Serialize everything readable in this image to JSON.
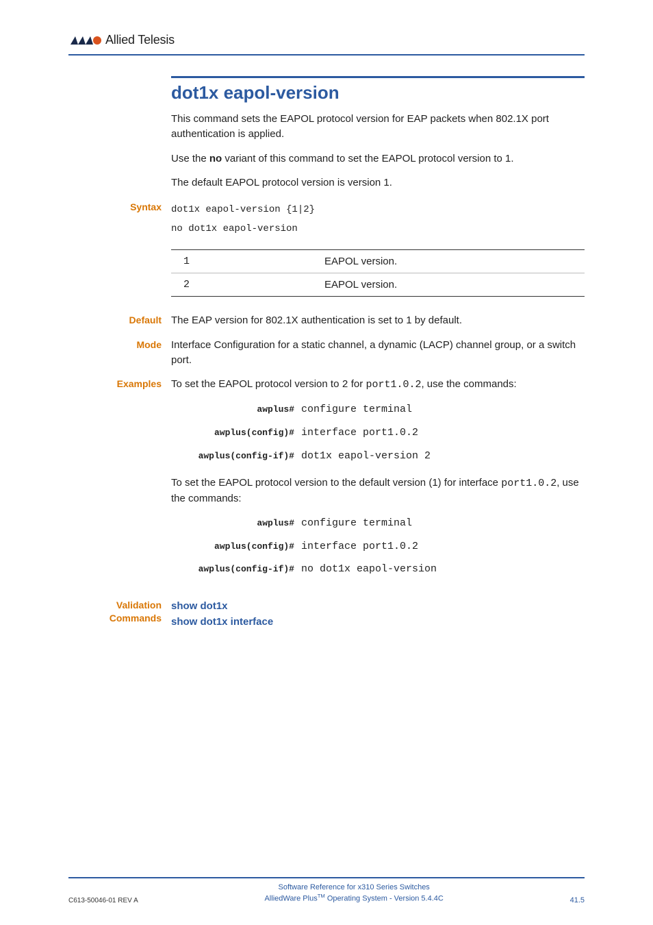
{
  "header": {
    "brand": "Allied Telesis"
  },
  "title": "dot1x eapol-version",
  "intro": {
    "p1": "This command sets the EAPOL protocol version for EAP packets when 802.1X port authentication is applied.",
    "p2_pre": "Use the ",
    "p2_bold": "no",
    "p2_post": " variant of this command to set the EAPOL protocol version to 1.",
    "p3": "The default EAPOL protocol version is version 1."
  },
  "labels": {
    "syntax": "Syntax",
    "default": "Default",
    "mode": "Mode",
    "examples": "Examples",
    "validation1": "Validation",
    "validation2": "Commands"
  },
  "syntax": {
    "line1": "dot1x eapol-version {1|2}",
    "line2": "no dot1x eapol-version"
  },
  "param_table": [
    {
      "param": "1",
      "desc": "EAPOL version."
    },
    {
      "param": "2",
      "desc": "EAPOL version."
    }
  ],
  "default_text": "The EAP version for 802.1X authentication is set to 1 by default.",
  "mode_text": "Interface Configuration for a static channel, a dynamic (LACP) channel group, or a switch port.",
  "examples": {
    "intro1_pre": "To set the EAPOL protocol version to ",
    "intro1_val": "2",
    "intro1_mid": " for ",
    "intro1_port": "port1.0.2",
    "intro1_post": ", use the commands:",
    "block1": [
      {
        "prompt": "awplus#",
        "cmd": "configure terminal"
      },
      {
        "prompt": "awplus(config)#",
        "cmd": "interface port1.0.2"
      },
      {
        "prompt": "awplus(config-if)#",
        "cmd": "dot1x eapol-version 2"
      }
    ],
    "intro2_pre": "To set the EAPOL protocol version to the default version (1) for interface ",
    "intro2_port": "port1.0.2",
    "intro2_post": ", use the commands:",
    "block2": [
      {
        "prompt": "awplus#",
        "cmd": "configure terminal"
      },
      {
        "prompt": "awplus(config)#",
        "cmd": "interface port1.0.2"
      },
      {
        "prompt": "awplus(config-if)#",
        "cmd": "no dot1x eapol-version"
      }
    ]
  },
  "validation_links": {
    "l1": "show dot1x",
    "l2": "show dot1x interface"
  },
  "footer": {
    "left": "C613-50046-01 REV A",
    "center1": "Software Reference for x310 Series Switches",
    "center2_pre": "AlliedWare Plus",
    "center2_tm": "TM",
    "center2_post": " Operating System - Version 5.4.4C",
    "right": "41.5"
  }
}
